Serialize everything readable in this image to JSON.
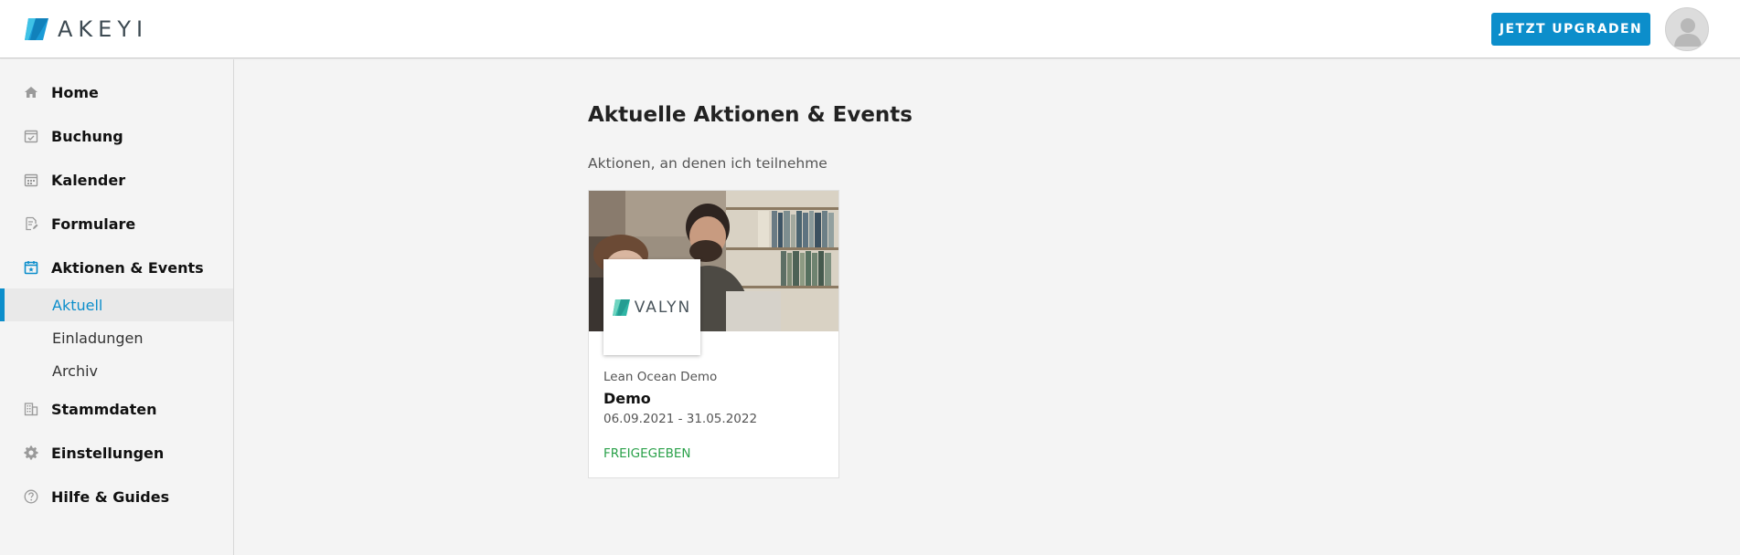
{
  "header": {
    "logo_text": "AKEYI",
    "upgrade_label": "JETZT UPGRADEN",
    "brand_color": "#0c8ecb"
  },
  "sidebar": {
    "items": [
      {
        "label": "Home",
        "icon": "home-icon"
      },
      {
        "label": "Buchung",
        "icon": "calendar-check-icon"
      },
      {
        "label": "Kalender",
        "icon": "calendar-icon"
      },
      {
        "label": "Formulare",
        "icon": "form-edit-icon"
      },
      {
        "label": "Aktionen & Events",
        "icon": "event-calendar-icon"
      },
      {
        "label": "Stammdaten",
        "icon": "building-icon"
      },
      {
        "label": "Einstellungen",
        "icon": "gear-icon"
      },
      {
        "label": "Hilfe & Guides",
        "icon": "help-icon"
      }
    ],
    "sub_items": [
      {
        "label": "Aktuell",
        "active": true
      },
      {
        "label": "Einladungen",
        "active": false
      },
      {
        "label": "Archiv",
        "active": false
      }
    ]
  },
  "main": {
    "title": "Aktuelle Aktionen & Events",
    "section_label": "Aktionen, an denen ich teilnehme",
    "card": {
      "logo_text": "VALYN",
      "organization": "Lean Ocean Demo",
      "title": "Demo",
      "dates": "06.09.2021 - 31.05.2022",
      "status": "FREIGEGEBEN",
      "status_color": "#2aa14a"
    }
  }
}
